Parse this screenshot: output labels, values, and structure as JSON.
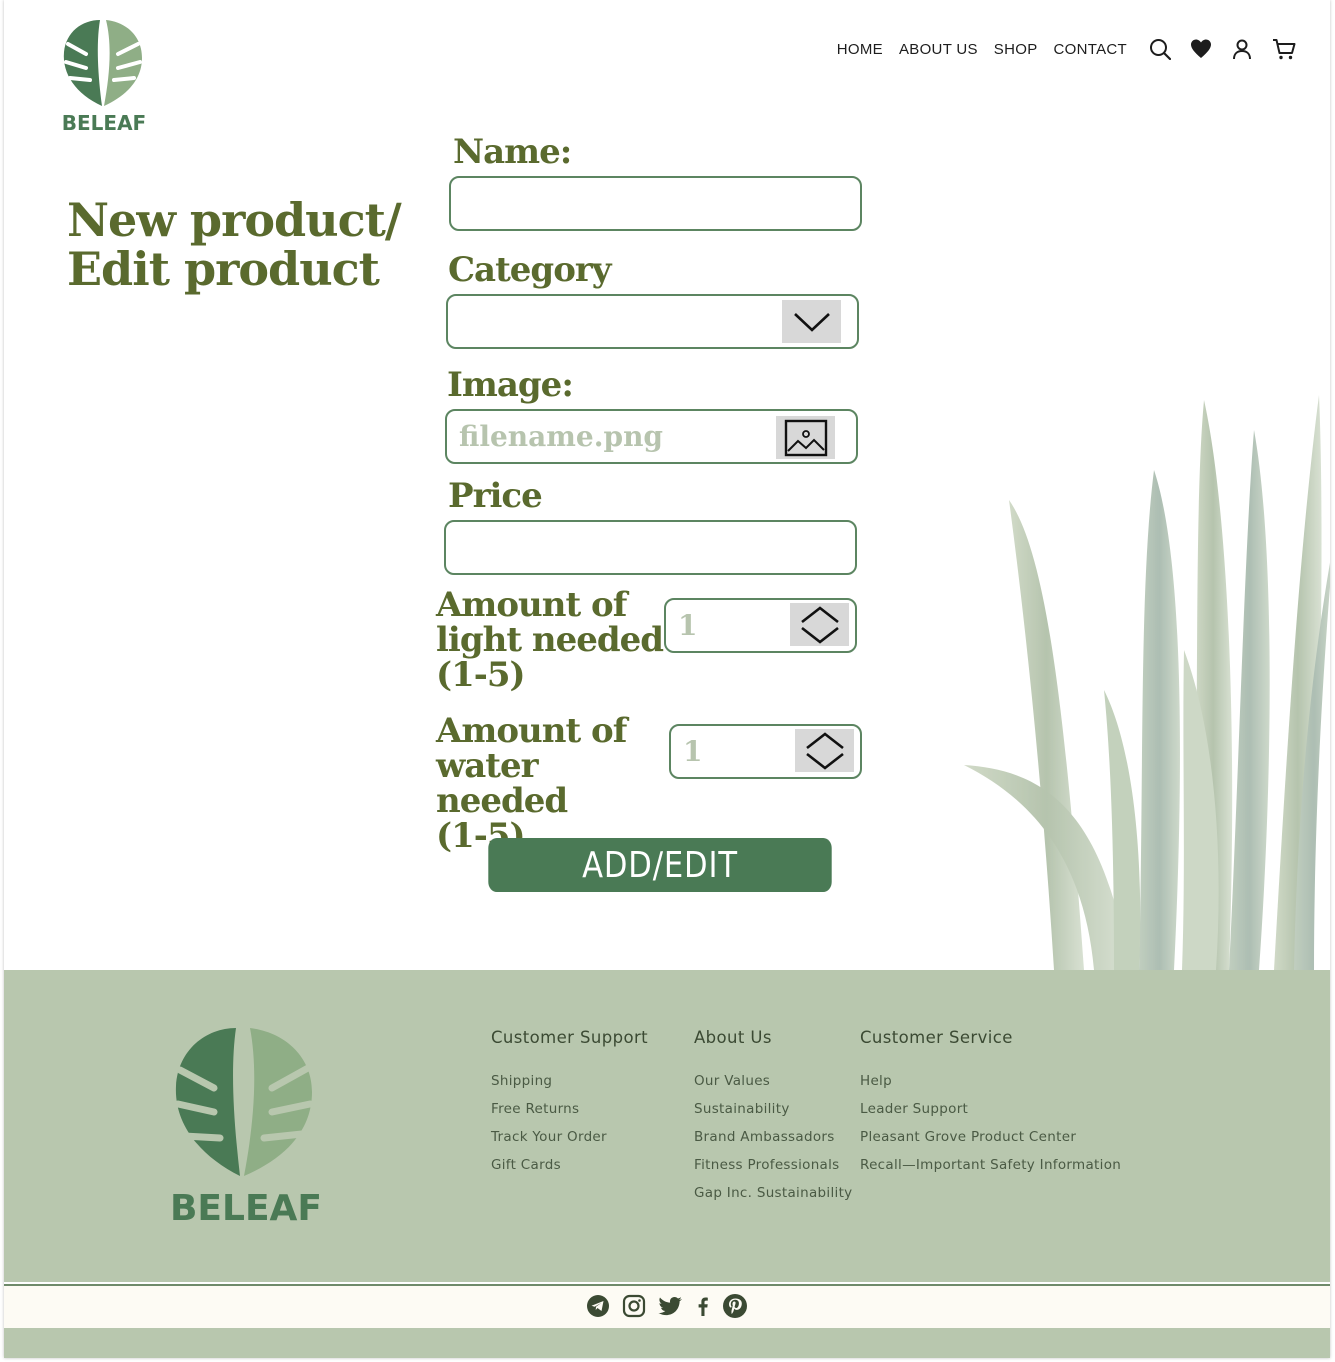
{
  "brand": {
    "name": "BELEAF"
  },
  "nav": {
    "links": [
      "HOME",
      "ABOUT US",
      "SHOP",
      "CONTACT"
    ],
    "icons": [
      "search-icon",
      "heart-icon",
      "user-icon",
      "cart-icon"
    ]
  },
  "page": {
    "title": "New product/\nEdit product"
  },
  "form": {
    "name_label": "Name:",
    "name_value": "",
    "category_label": "Category",
    "category_value": "",
    "image_label": "Image:",
    "image_placeholder": "filename.png",
    "price_label": "Price",
    "price_value": "",
    "light_label": "Amount of\nlight needed\n(1-5)",
    "light_placeholder": "1",
    "water_label": "Amount of\nwater needed\n(1-5)",
    "water_placeholder": "1",
    "submit_label": "ADD/EDIT"
  },
  "footer": {
    "columns": [
      {
        "title": "Customer Support",
        "links": [
          "Shipping",
          "Free Returns",
          "Track Your Order",
          "Gift Cards"
        ]
      },
      {
        "title": "About Us",
        "links": [
          "Our Values",
          "Sustainability",
          "Brand Ambassadors",
          "Fitness Professionals",
          "Gap Inc. Sustainability"
        ]
      },
      {
        "title": "Customer Service",
        "links": [
          "Help",
          "Leader Support",
          "Pleasant Grove Product Center",
          "Recall—Important Safety Information"
        ]
      }
    ],
    "social_icons": [
      "telegram-icon",
      "instagram-icon",
      "twitter-icon",
      "facebook-icon",
      "pinterest-icon"
    ]
  },
  "colors": {
    "olive": "#5a6a2e",
    "green": "#4a7a55",
    "footer_bg": "#b8c7ae",
    "field_border": "#5c8561"
  }
}
